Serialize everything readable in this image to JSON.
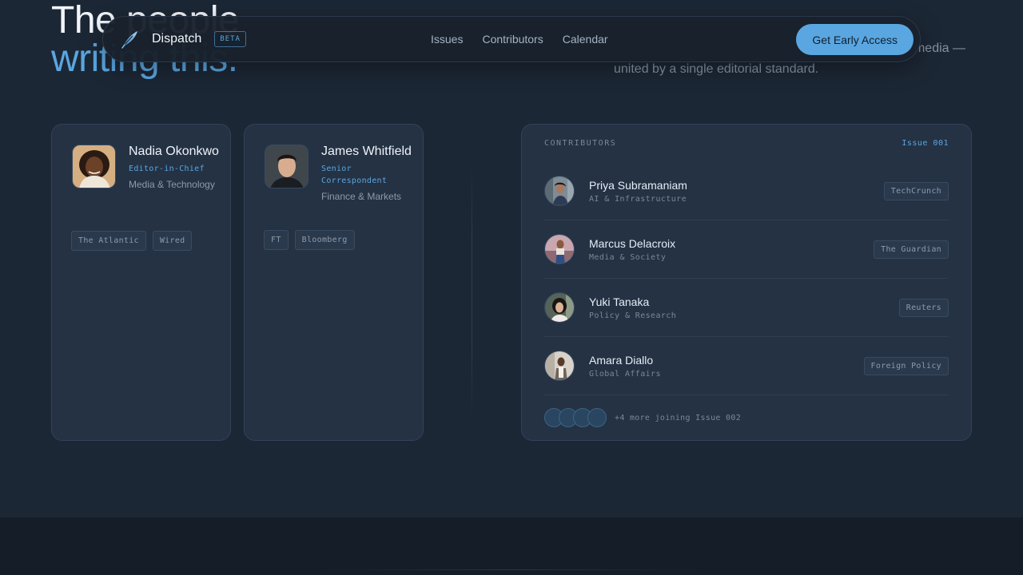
{
  "hero": {
    "title_line1": "The people",
    "title_line2": "writing this.",
    "subtitle_line1": "media —",
    "subtitle_line2": "united by a single editorial standard."
  },
  "navbar": {
    "brand": "Dispatch",
    "badge": "BETA",
    "links": [
      "Issues",
      "Contributors",
      "Calendar"
    ],
    "cta": "Get Early Access"
  },
  "profiles": [
    {
      "name": "Nadia Okonkwo",
      "role": "Editor-in-Chief",
      "beat": "Media & Technology",
      "tags": [
        "The Atlantic",
        "Wired"
      ]
    },
    {
      "name": "James Whitfield",
      "role": "Senior Correspondent",
      "beat": "Finance & Markets",
      "tags": [
        "FT",
        "Bloomberg"
      ]
    }
  ],
  "contributors": {
    "label": "CONTRIBUTORS",
    "issue": "Issue 001",
    "rows": [
      {
        "name": "Priya Subramaniam",
        "topic": "AI & Infrastructure",
        "outlet": "TechCrunch"
      },
      {
        "name": "Marcus Delacroix",
        "topic": "Media & Society",
        "outlet": "The Guardian"
      },
      {
        "name": "Yuki Tanaka",
        "topic": "Policy & Research",
        "outlet": "Reuters"
      },
      {
        "name": "Amara Diallo",
        "topic": "Global Affairs",
        "outlet": "Foreign Policy"
      }
    ],
    "more": "+4 more joining Issue 002"
  },
  "colors": {
    "accent": "#5aa6e0",
    "background": "#1c2735",
    "card": "#243244"
  },
  "icons": {
    "brand": "quill-icon"
  }
}
